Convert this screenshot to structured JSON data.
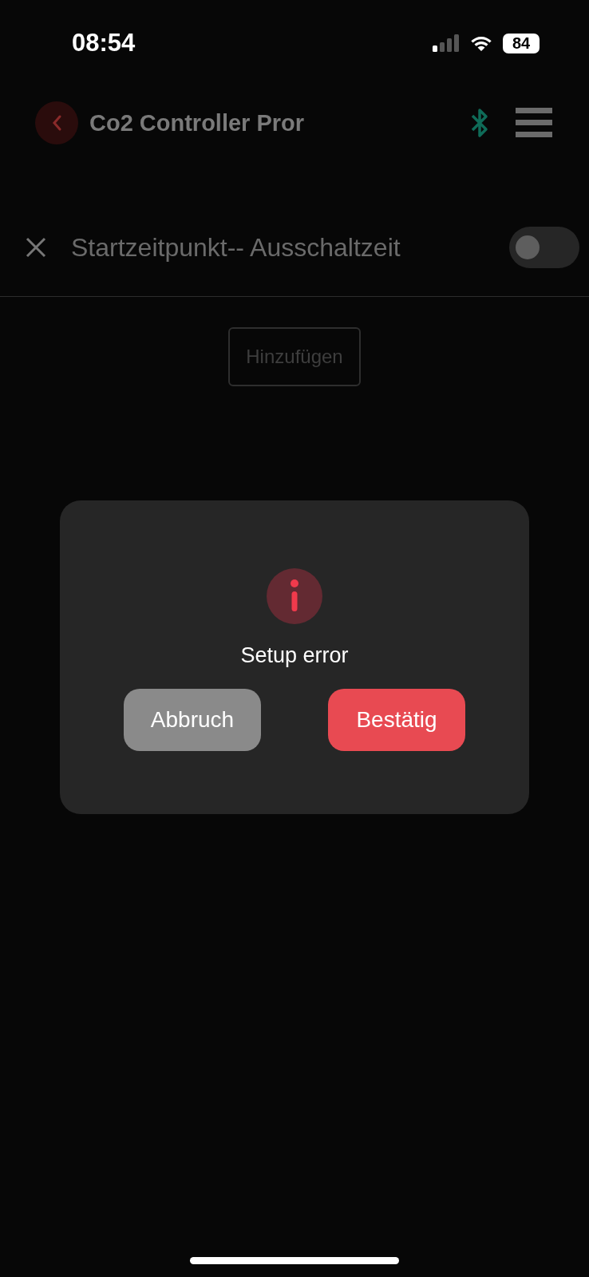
{
  "status_bar": {
    "time": "08:54",
    "battery": "84"
  },
  "header": {
    "title": "Co2 Controller Pror"
  },
  "schedule_row": {
    "label": "Startzeitpunkt-- Ausschaltzeit",
    "on": false
  },
  "add_button": {
    "label": "Hinzufügen"
  },
  "dialog": {
    "message": "Setup error",
    "buttons": [
      {
        "label": "Abbruch",
        "kind": "cancel"
      },
      {
        "label": "Bestätig",
        "kind": "confirm"
      }
    ]
  }
}
